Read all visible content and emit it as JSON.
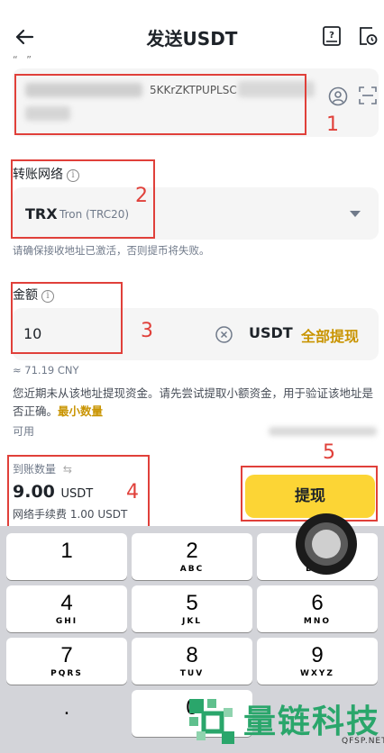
{
  "header": {
    "title": "发送USDT",
    "cut_text": "“ ”"
  },
  "address": {
    "value": "",
    "visible_fragment": "5KKrZKTPUPLSC"
  },
  "network": {
    "label": "转账网络",
    "info_symbol": "i",
    "symbol": "TRX",
    "name": "Tron (TRC20)",
    "hint": "请确保接收地址已激活，否则提币将失败。"
  },
  "amount": {
    "label": "金额",
    "info_symbol": "i",
    "value": "10",
    "unit": "USDT",
    "max_label": "全部提现",
    "approx": "≈ 71.19 CNY"
  },
  "warning": {
    "text": "您近期未从该地址提现资金。请先尝试提取小额资金，用于验证该地址是否正确。",
    "link": "最小数量"
  },
  "available": {
    "label": "可用"
  },
  "receive": {
    "label": "到账数量",
    "swap_symbol": "⇆",
    "value": "9.00",
    "unit": "USDT",
    "fee": "网络手续费 1.00 USDT"
  },
  "withdraw_button": "提现",
  "annotations": [
    "1",
    "2",
    "3",
    "4",
    "5"
  ],
  "keyboard": {
    "keys": [
      {
        "num": "1",
        "letters": ""
      },
      {
        "num": "2",
        "letters": "ABC"
      },
      {
        "num": "3",
        "letters": "DEF"
      },
      {
        "num": "4",
        "letters": "GHI"
      },
      {
        "num": "5",
        "letters": "JKL"
      },
      {
        "num": "6",
        "letters": "MNO"
      },
      {
        "num": "7",
        "letters": "PQRS"
      },
      {
        "num": "8",
        "letters": "TUV"
      },
      {
        "num": "9",
        "letters": "WXYZ"
      },
      {
        "num": ".",
        "letters": ""
      },
      {
        "num": "0",
        "letters": ""
      }
    ]
  },
  "watermark": {
    "text": "量链科技",
    "sub": "QFSP.NET"
  },
  "colors": {
    "accent_yellow": "#fcd535",
    "accent_gold": "#c99400",
    "annotation_red": "#e0403a",
    "watermark_green": "#2aa66b"
  }
}
